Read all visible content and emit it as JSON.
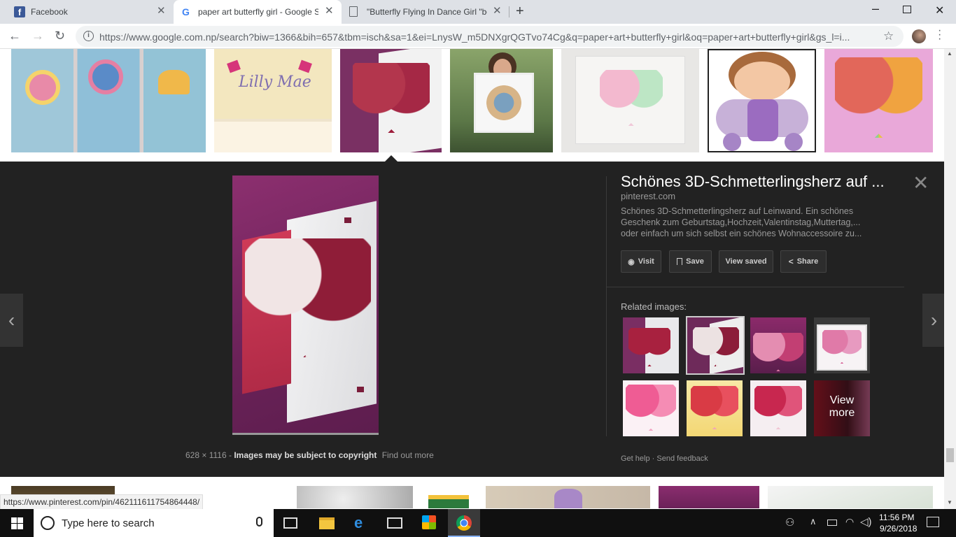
{
  "browser": {
    "tabs": [
      {
        "title": "Facebook",
        "active": false
      },
      {
        "title": "paper art butterfly girl - Google S",
        "active": true
      },
      {
        "title": "\"Butterfly Flying In Dance Girl \"be",
        "active": false
      }
    ],
    "url": "https://www.google.com.np/search?biw=1366&bih=657&tbm=isch&sa=1&ei=LnysW_m5DNXgrQGTvo74Cg&q=paper+art+butterfly+girl&oq=paper+art+butterfly+girl&gs_l=i..."
  },
  "detail": {
    "title": "Schönes 3D-Schmetterlingsherz auf ...",
    "site": "pinterest.com",
    "description": "Schönes 3D-Schmetterlingsherz auf Leinwand. Ein schönes Geschenk zum Geburtstag,Hochzeit,Valentinstag,Muttertag,... oder einfach um sich selbst ein schönes Wohnaccessoire zu...",
    "buttons": {
      "visit": "Visit",
      "save": "Save",
      "view_saved": "View saved",
      "share": "Share"
    },
    "related_label": "Related images:",
    "view_more": "View more",
    "dimensions": "628 × 1116",
    "copyright": "Images may be subject to copyright",
    "find_out_more": "Find out more",
    "get_help": "Get help",
    "send_feedback": "Send feedback",
    "image_text": "Lilly Mae"
  },
  "status_url": "https://www.pinterest.com/pin/462111611754864448/",
  "taskbar": {
    "search_placeholder": "Type here to search",
    "time": "11:56 PM",
    "date": "9/26/2018"
  },
  "colors": {
    "panel_bg": "#222222",
    "tab_bar": "#dee1e6",
    "taskbar": "#101010"
  }
}
